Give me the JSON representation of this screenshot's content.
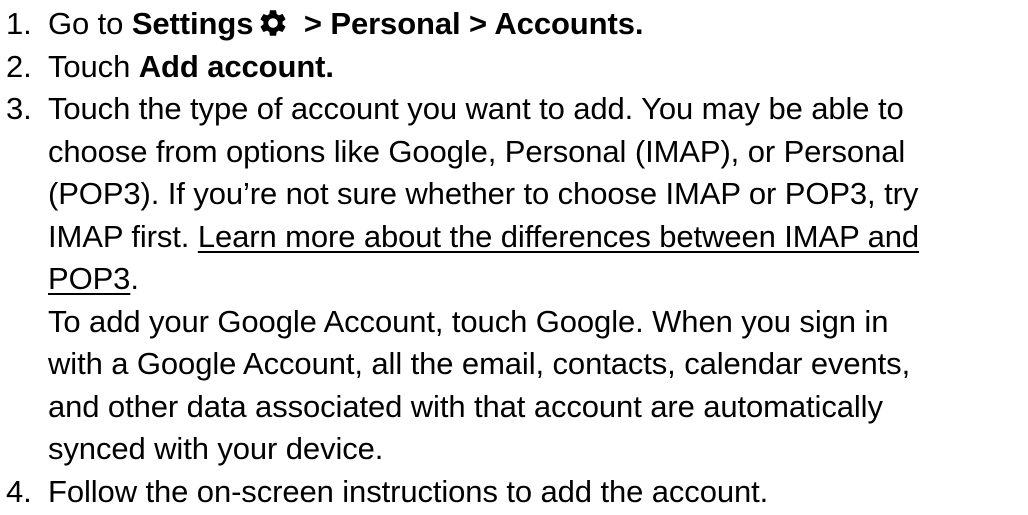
{
  "steps": [
    {
      "number": "1.",
      "lines": [
        {
          "t1": "Go to ",
          "b1": "Settings",
          "t2": " > Personal > Accounts."
        }
      ]
    },
    {
      "number": "2.",
      "lines": [
        {
          "t1": "Touch ",
          "b1": "Add account."
        }
      ]
    },
    {
      "number": "3.",
      "lines": [
        "Touch the type of account you want to add. You may be able to",
        "choose from options like Google, Personal (IMAP), or Personal",
        "(POP3). If you’re not sure whether to choose IMAP or POP3, try",
        {
          "t1": "IMAP first. ",
          "link1": "Learn more about the differences between IMAP and"
        },
        {
          "link2": "POP3",
          "t2": "."
        },
        "To add your Google Account, touch Google. When you sign in",
        "with a Google Account, all the email, contacts, calendar events,",
        "and other data associated with that account are automatically",
        "synced with your device."
      ]
    },
    {
      "number": "4.",
      "lines": [
        "Follow the on-screen instructions to add the account."
      ]
    }
  ],
  "icons": {
    "settings": "gear-icon"
  }
}
